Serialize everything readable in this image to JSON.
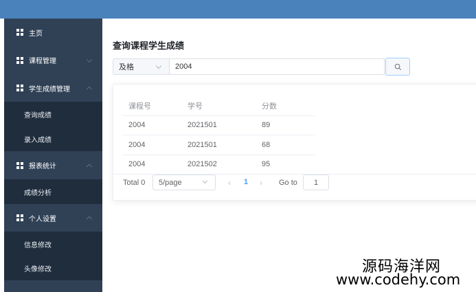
{
  "sidebar": {
    "items": [
      {
        "label": "主页",
        "icon": "grid-icon",
        "type": "group"
      },
      {
        "label": "课程管理",
        "icon": "grid-icon",
        "type": "group"
      },
      {
        "label": "学生成绩管理",
        "icon": "grid-icon",
        "type": "group",
        "expanded": true
      },
      {
        "label": "查询成绩",
        "type": "sub"
      },
      {
        "label": "录入成绩",
        "type": "sub"
      },
      {
        "label": "报表统计",
        "icon": "grid-icon",
        "type": "group",
        "expanded": true
      },
      {
        "label": "成绩分析",
        "type": "sub"
      },
      {
        "label": "个人设置",
        "icon": "grid-icon",
        "type": "group",
        "expanded": true
      },
      {
        "label": "信息修改",
        "type": "sub"
      },
      {
        "label": "头像修改",
        "type": "sub"
      }
    ]
  },
  "main": {
    "title": "查询课程学生成绩",
    "filter": {
      "selected": "及格",
      "search_value": "2004",
      "search_icon": "search-icon"
    },
    "table": {
      "headers": [
        "课程号",
        "学号",
        "分数"
      ],
      "rows": [
        [
          "2004",
          "2021501",
          "89"
        ],
        [
          "2004",
          "2021501",
          "68"
        ],
        [
          "2004",
          "2021502",
          "95"
        ]
      ]
    },
    "pagination": {
      "total": "Total 0",
      "page_size": "5/page",
      "prev": "‹",
      "current_page": "1",
      "next": "›",
      "goto_label": "Go to",
      "goto_value": "1"
    }
  },
  "watermark": {
    "line1": "源码海洋网",
    "line2": "www.codehy.com"
  },
  "colors": {
    "topbar": "#4a82bc",
    "sidebar_group": "#304156",
    "sidebar_sub": "#1f2d3d",
    "accent": "#409eff"
  }
}
